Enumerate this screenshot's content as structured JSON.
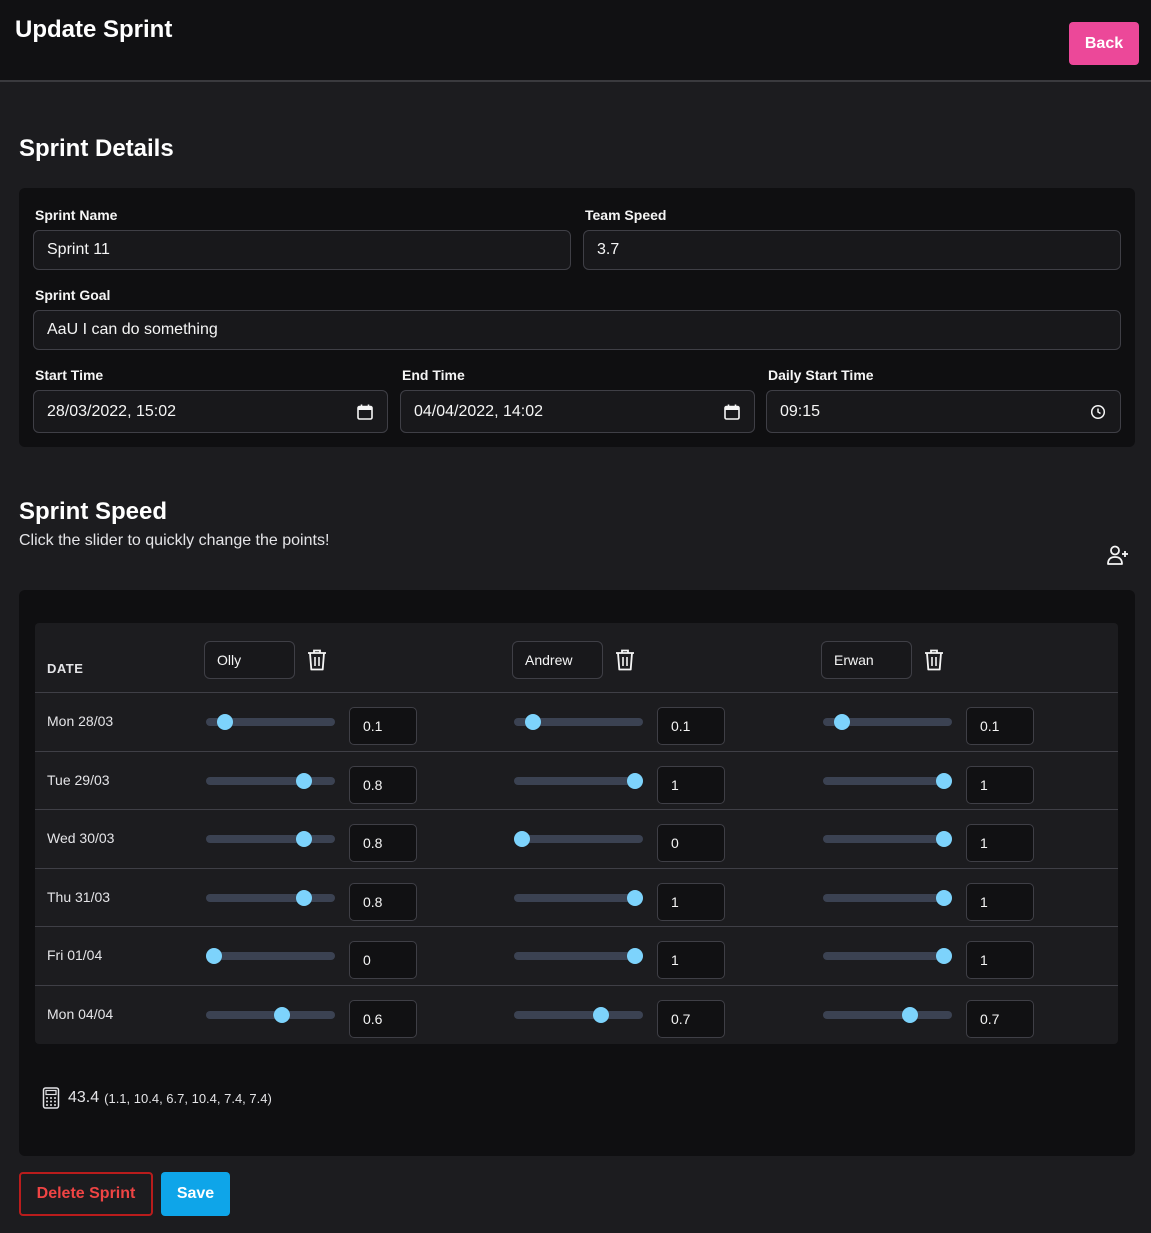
{
  "header": {
    "title": "Update Sprint",
    "back_label": "Back"
  },
  "details": {
    "title": "Sprint Details",
    "sprint_name_label": "Sprint Name",
    "sprint_name_value": "Sprint 11",
    "team_speed_label": "Team Speed",
    "team_speed_value": "3.7",
    "sprint_goal_label": "Sprint Goal",
    "sprint_goal_value": "AaU I can do something",
    "start_time_label": "Start Time",
    "start_time_value": "28/03/2022, 15:02",
    "end_time_label": "End Time",
    "end_time_value": "04/04/2022, 14:02",
    "daily_start_label": "Daily Start Time",
    "daily_start_value": "09:15"
  },
  "speed": {
    "title": "Sprint Speed",
    "subtitle": "Click the slider to quickly change the points!",
    "date_header": "DATE",
    "members": [
      {
        "name": "Olly"
      },
      {
        "name": "Andrew"
      },
      {
        "name": "Erwan"
      }
    ],
    "rows": [
      {
        "date": "Mon 28/03",
        "values": [
          "0.1",
          "0.1",
          "0.1"
        ]
      },
      {
        "date": "Tue 29/03",
        "values": [
          "0.8",
          "1",
          "1"
        ]
      },
      {
        "date": "Wed 30/03",
        "values": [
          "0.8",
          "0",
          "1"
        ]
      },
      {
        "date": "Thu 31/03",
        "values": [
          "0.8",
          "1",
          "1"
        ]
      },
      {
        "date": "Fri 01/04",
        "values": [
          "0",
          "1",
          "1"
        ]
      },
      {
        "date": "Mon 04/04",
        "values": [
          "0.6",
          "0.7",
          "0.7"
        ]
      }
    ],
    "total_value": "43.4",
    "total_breakdown": "(1.1, 10.4, 6.7, 10.4, 7.4, 7.4)",
    "accent_color": "#7dd3fc"
  },
  "actions": {
    "delete_label": "Delete Sprint",
    "save_label": "Save"
  }
}
